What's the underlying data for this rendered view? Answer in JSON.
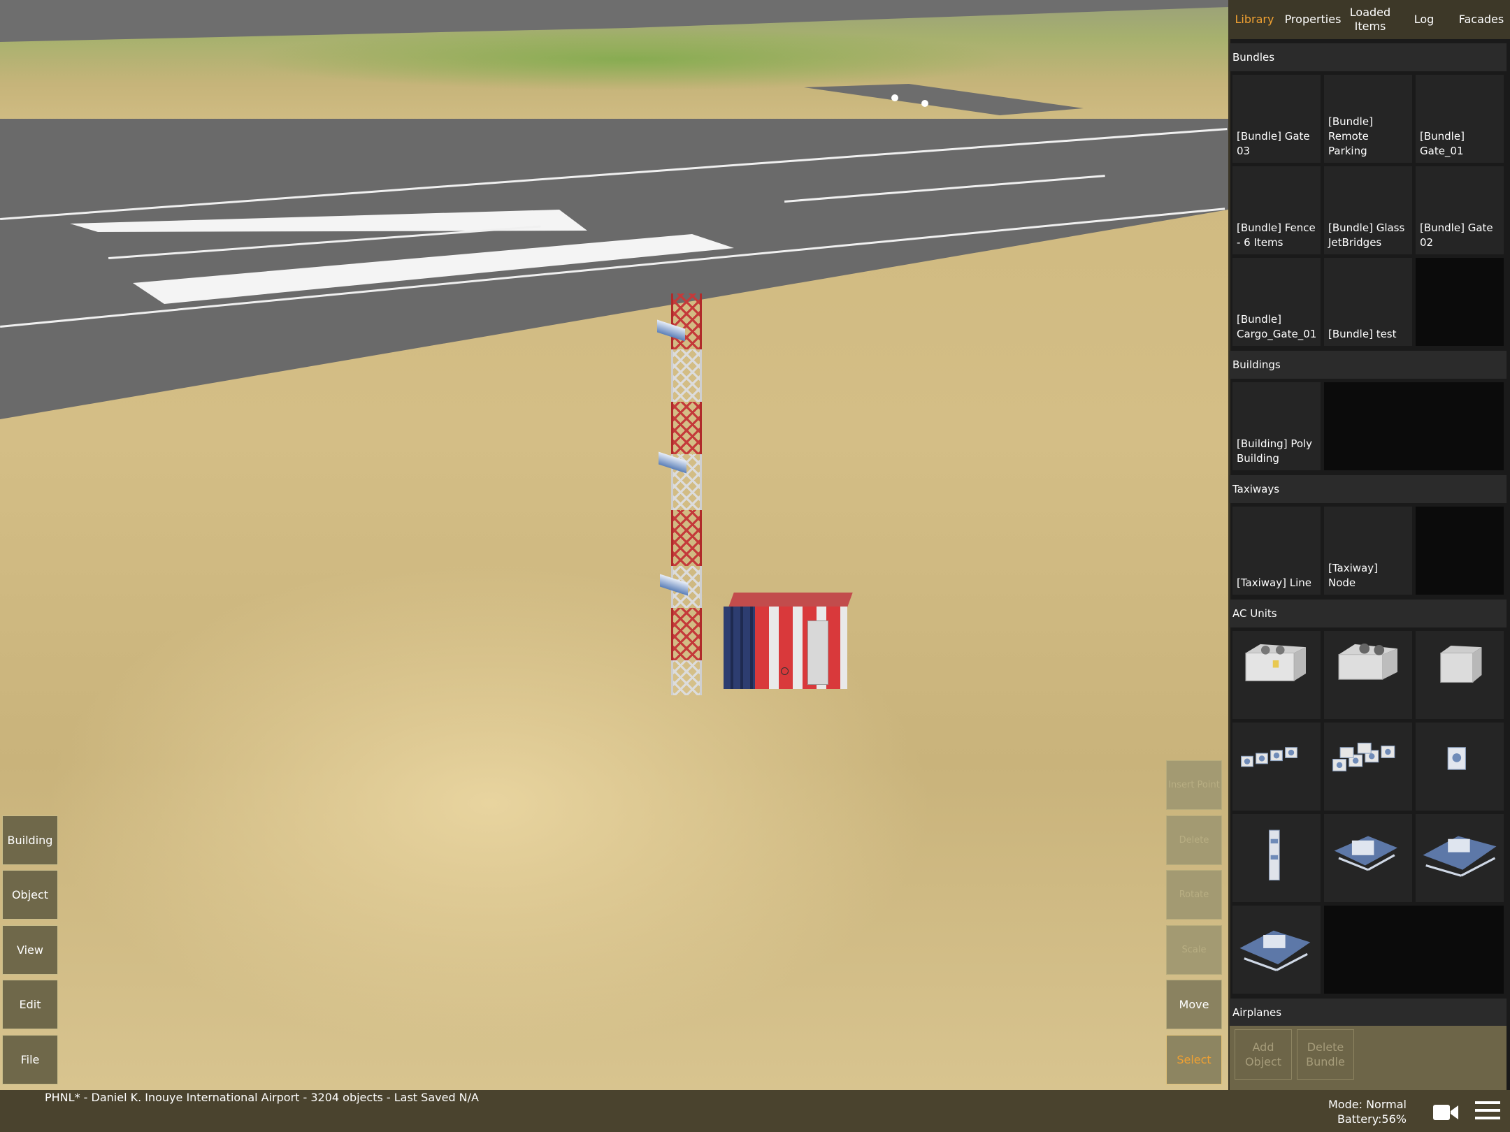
{
  "status": {
    "project_line": "PHNL* - Daniel K. Inouye International Airport - 3204 objects - Last Saved N/A",
    "mode": "Mode: Normal",
    "battery": "Battery:56%"
  },
  "left_modes": [
    "Building",
    "Object",
    "View",
    "Edit",
    "File"
  ],
  "tools": {
    "disabled_1": "Insert Point",
    "disabled_2": "Delete",
    "disabled_3": "Rotate",
    "disabled_4": "Scale",
    "move": "Move",
    "select": "Select"
  },
  "tabs": [
    {
      "label": "Library",
      "active": true
    },
    {
      "label": "Properties",
      "active": false
    },
    {
      "label": "Loaded Items",
      "active": false
    },
    {
      "label": "Log",
      "active": false
    },
    {
      "label": "Facades",
      "active": false
    }
  ],
  "library": {
    "bundles": {
      "header": "Bundles",
      "items": [
        "[Bundle] Gate 03",
        "[Bundle] Remote Parking",
        "[Bundle] Gate_01",
        "[Bundle] Fence - 6 Items",
        "[Bundle] Glass JetBridges",
        "[Bundle] Gate 02",
        "[Bundle] Cargo_Gate_01",
        "[Bundle] test"
      ]
    },
    "buildings": {
      "header": "Buildings",
      "items": [
        "[Building] Poly Building"
      ]
    },
    "taxiways": {
      "header": "Taxiways",
      "items": [
        "[Taxiway] Line",
        "[Taxiway] Node"
      ]
    },
    "ac_units": {
      "header": "AC Units",
      "count": 10
    },
    "airplanes": {
      "header": "Airplanes"
    }
  },
  "bottom_buttons": {
    "add_object": "Add Object",
    "delete_bundle": "Delete Bundle"
  },
  "colors": {
    "accent": "#f0a132",
    "status_bar": "#4a432e",
    "panel_bg": "#1a1a1a"
  }
}
